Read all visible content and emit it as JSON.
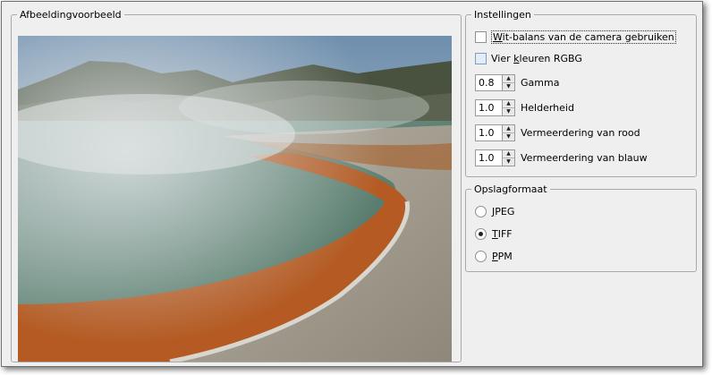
{
  "preview": {
    "title": "Afbeeldingvoorbeeld"
  },
  "settings": {
    "title": "Instellingen",
    "white_balance": {
      "before": "",
      "mnemonic": "W",
      "after": "it-balans van de camera gebruiken",
      "checked": false
    },
    "four_colors": {
      "before": "Vier ",
      "mnemonic": "k",
      "after": "leuren RGBG",
      "checked": false
    },
    "spinners": [
      {
        "value": "0.8",
        "label": "Gamma"
      },
      {
        "value": "1.0",
        "label": "Helderheid"
      },
      {
        "value": "1.0",
        "label": "Vermeerdering van rood"
      },
      {
        "value": "1.0",
        "label": "Vermeerdering van blauw"
      }
    ]
  },
  "format": {
    "title": "Opslagformaat",
    "options": [
      {
        "mnemonic": "J",
        "rest": "PEG",
        "selected": false
      },
      {
        "mnemonic": "T",
        "rest": "IFF",
        "selected": true
      },
      {
        "mnemonic": "P",
        "rest": "PM",
        "selected": false
      }
    ]
  },
  "icons": {
    "spin_up": "arrow-up-icon",
    "spin_down": "arrow-down-icon"
  },
  "colors": {
    "window_bg": "#efefef",
    "group_border": "#a9a9a9",
    "focus_checkbox": "#7a9cc6"
  }
}
